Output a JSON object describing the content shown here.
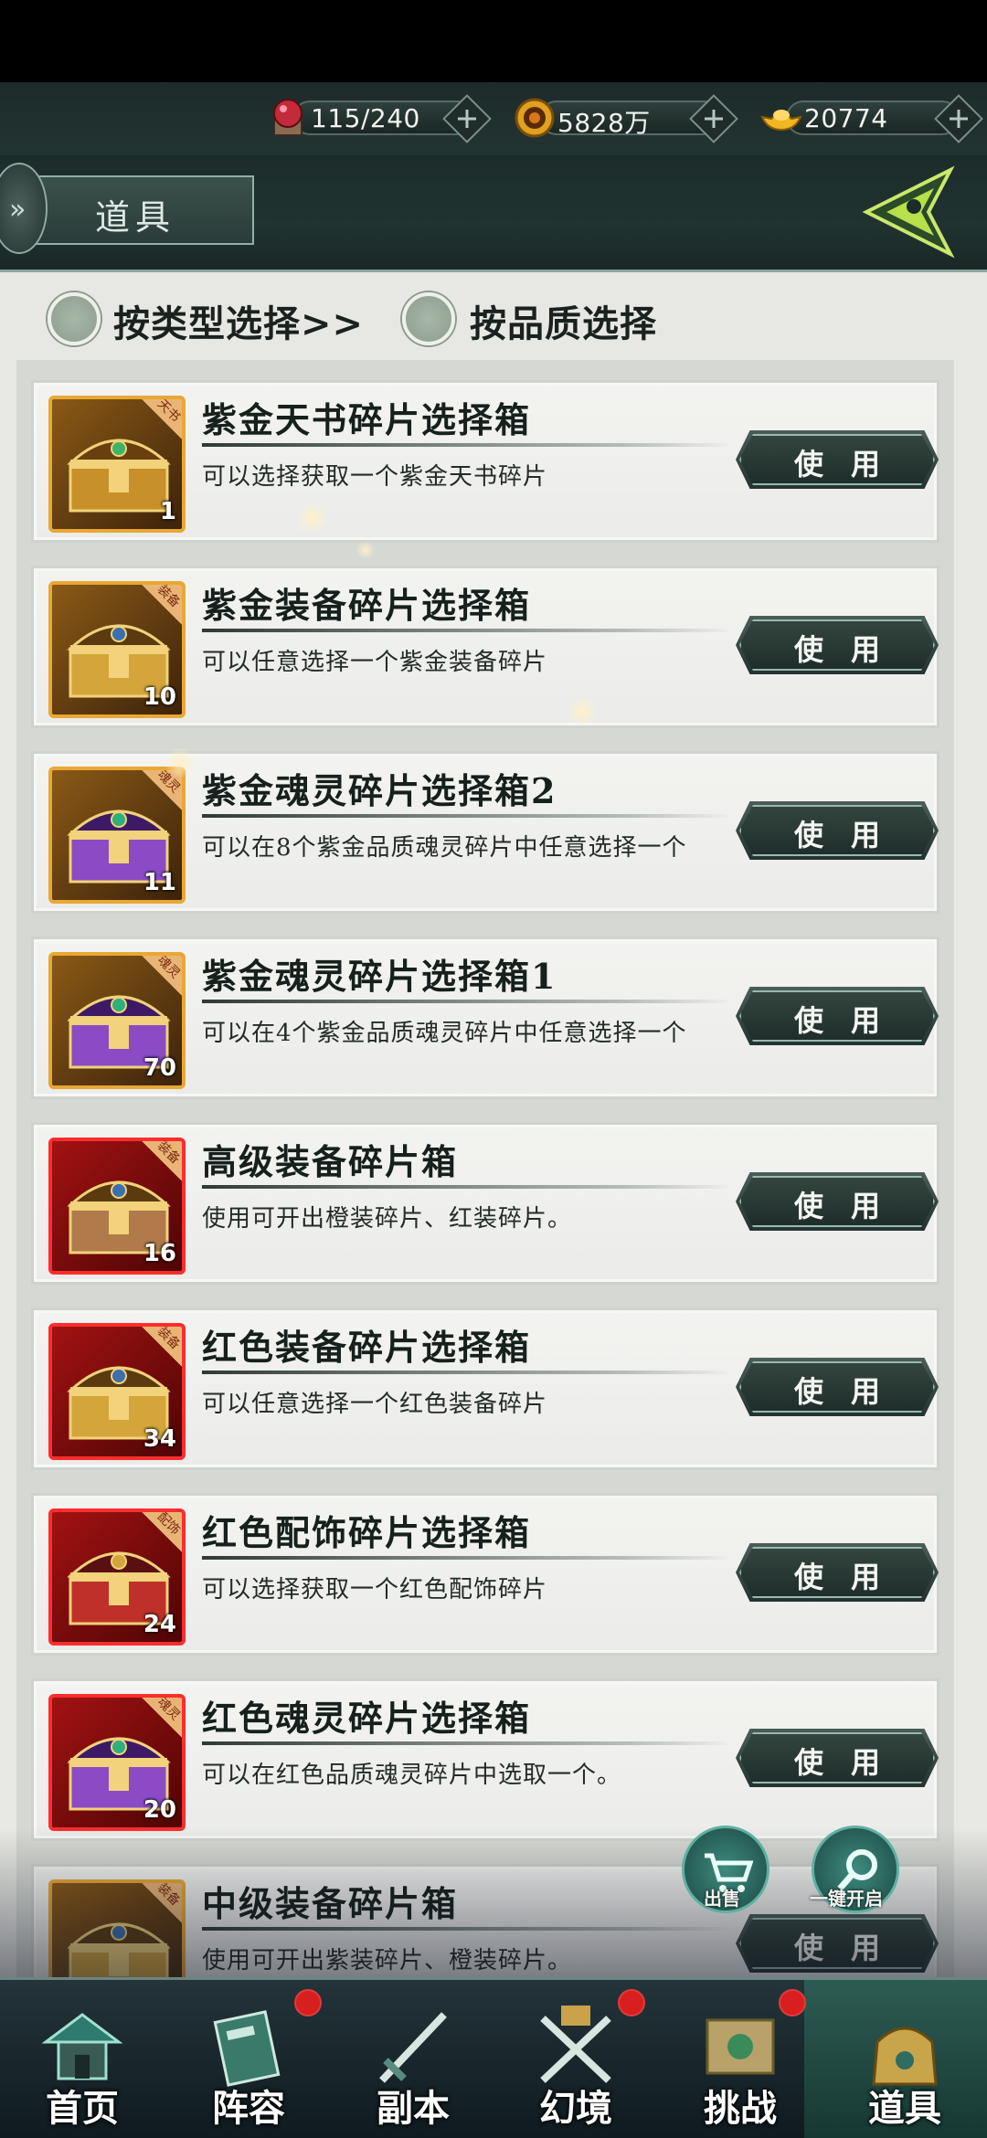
{
  "resources": {
    "stamina": {
      "value": "115/240",
      "icon": "red-orb-icon"
    },
    "coins": {
      "value": "5828万",
      "icon": "coin-icon"
    },
    "ingots": {
      "value": "20774",
      "icon": "gold-ingot-icon"
    }
  },
  "header": {
    "title": "道具"
  },
  "filters": {
    "by_type": "按类型选择>>",
    "by_quality": "按品质选择"
  },
  "items": [
    {
      "name": "紫金天书碎片选择箱",
      "desc": "可以选择获取一个紫金天书碎片",
      "count": "1",
      "tag": "天书",
      "frame": "gold",
      "use": "使用"
    },
    {
      "name": "紫金装备碎片选择箱",
      "desc": "可以任意选择一个紫金装备碎片",
      "count": "10",
      "tag": "装备",
      "frame": "gold",
      "use": "使用"
    },
    {
      "name": "紫金魂灵碎片选择箱2",
      "desc": "可以在8个紫金品质魂灵碎片中任意选择一个",
      "count": "11",
      "tag": "魂灵",
      "frame": "gold",
      "use": "使用"
    },
    {
      "name": "紫金魂灵碎片选择箱1",
      "desc": "可以在4个紫金品质魂灵碎片中任意选择一个",
      "count": "70",
      "tag": "魂灵",
      "frame": "gold",
      "use": "使用"
    },
    {
      "name": "高级装备碎片箱",
      "desc": "使用可开出橙装碎片、红装碎片。",
      "count": "16",
      "tag": "装备",
      "frame": "red",
      "use": "使用"
    },
    {
      "name": "红色装备碎片选择箱",
      "desc": "可以任意选择一个红色装备碎片",
      "count": "34",
      "tag": "装备",
      "frame": "red",
      "use": "使用"
    },
    {
      "name": "红色配饰碎片选择箱",
      "desc": "可以选择获取一个红色配饰碎片",
      "count": "24",
      "tag": "配饰",
      "frame": "red",
      "use": "使用"
    },
    {
      "name": "红色魂灵碎片选择箱",
      "desc": "可以在红色品质魂灵碎片中选取一个。",
      "count": "20",
      "tag": "魂灵",
      "frame": "red",
      "use": "使用"
    },
    {
      "name": "中级装备碎片箱",
      "desc": "使用可开出紫装碎片、橙装碎片。",
      "count": "",
      "tag": "装备",
      "frame": "gold",
      "use": "使用"
    }
  ],
  "floating": {
    "sell": "出售",
    "open_all": "一键开启"
  },
  "nav": [
    {
      "label": "首页",
      "icon": "pagoda-icon"
    },
    {
      "label": "阵容",
      "icon": "scroll-icon"
    },
    {
      "label": "副本",
      "icon": "sword-icon"
    },
    {
      "label": "幻境",
      "icon": "crossed-swords-icon"
    },
    {
      "label": "挑战",
      "icon": "map-scroll-icon"
    },
    {
      "label": "道具",
      "icon": "bag-icon"
    }
  ]
}
